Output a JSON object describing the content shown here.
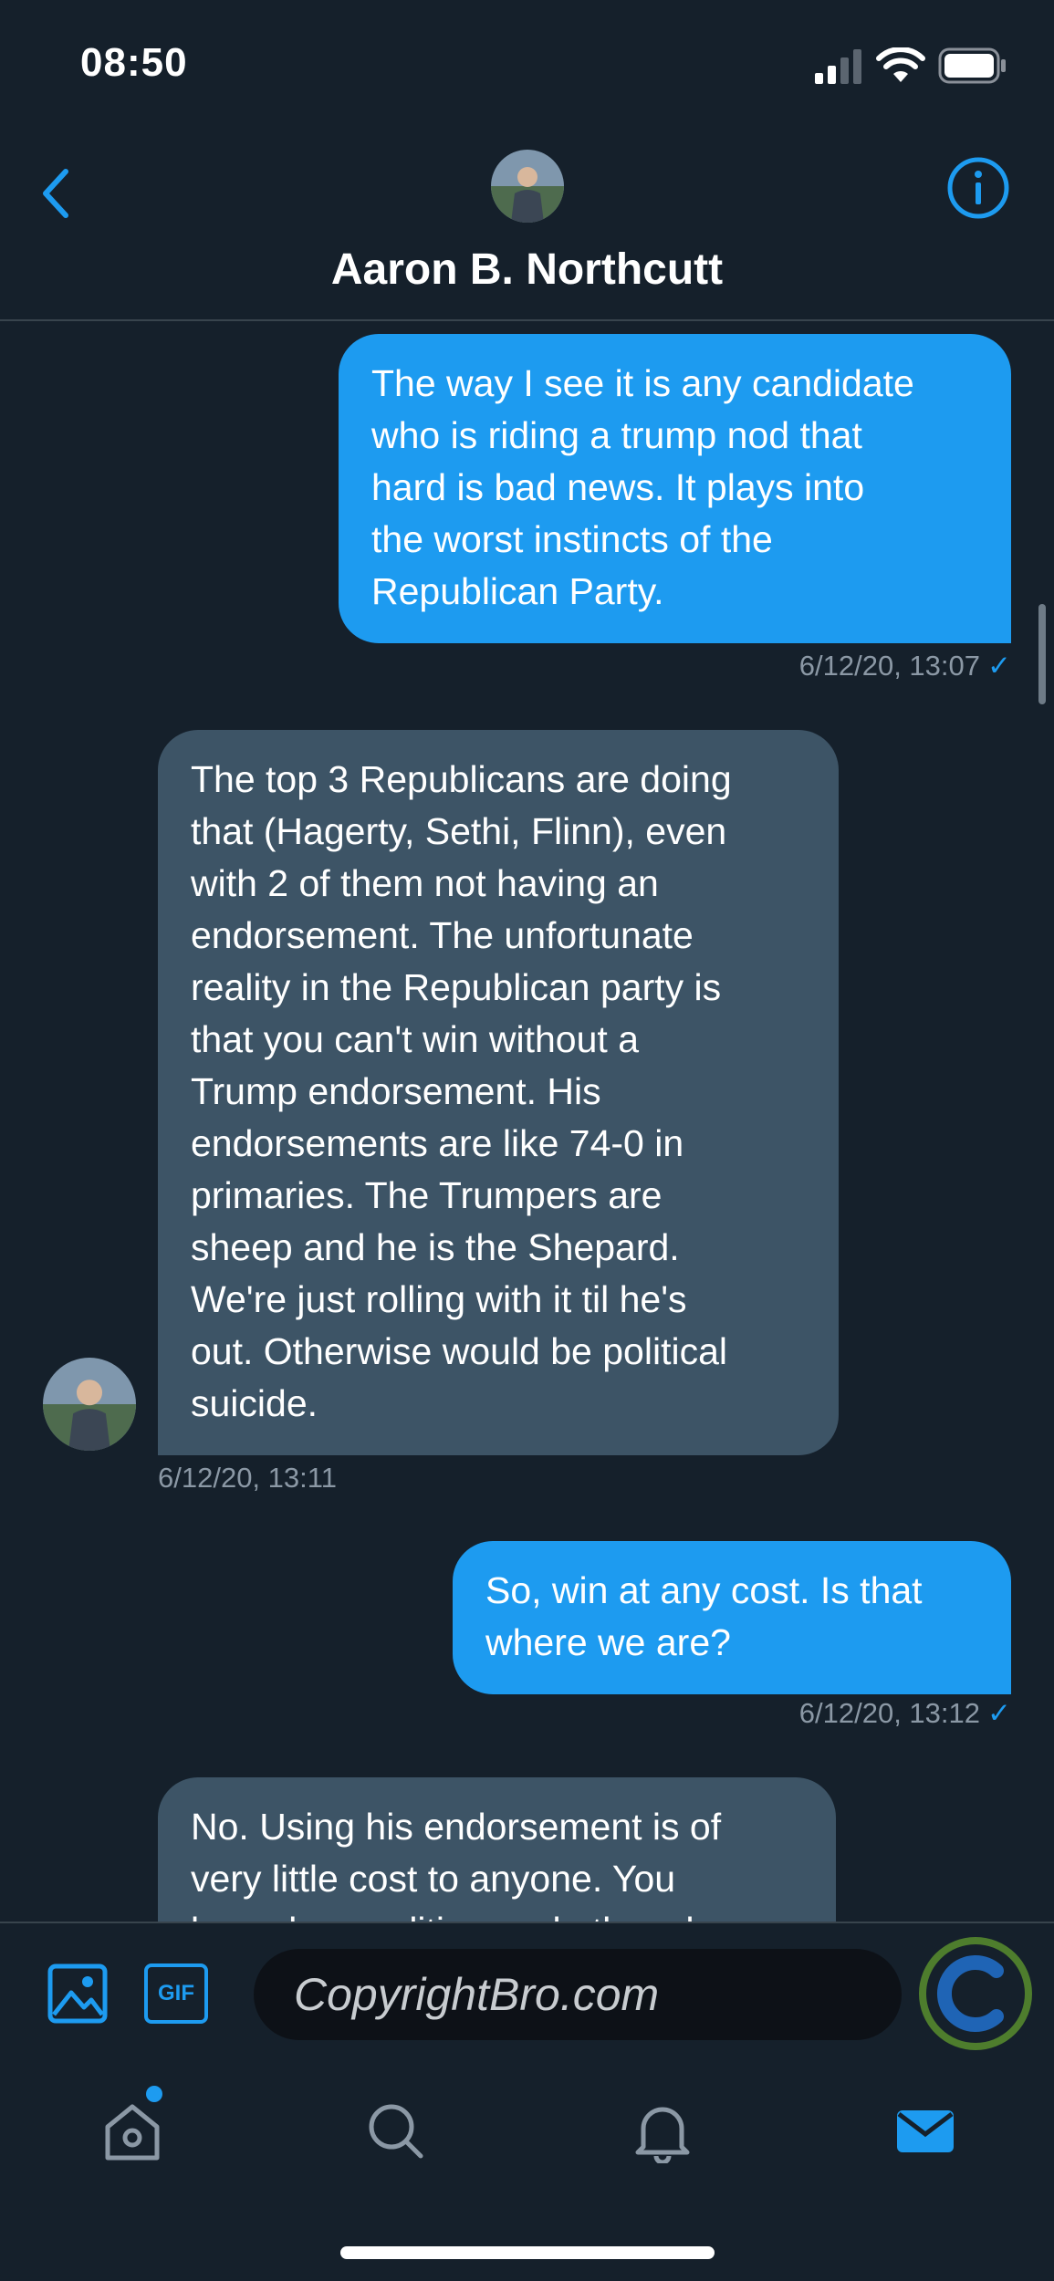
{
  "status_bar": {
    "time": "08:50"
  },
  "header": {
    "title": "Aaron B. Northcutt"
  },
  "messages": [
    {
      "direction": "sent",
      "text": "The way I see it is any candidate\nwho is riding a trump nod that\nhard is bad news. It plays into\nthe worst instincts of the\nRepublican Party.",
      "timestamp": "6/12/20, 13:07",
      "read_mark": "✓"
    },
    {
      "direction": "received",
      "text": "The top 3 Republicans are doing\nthat (Hagerty, Sethi, Flinn), even\nwith 2 of them not having an\nendorsement. The unfortunate\nreality in the Republican party is\nthat you can't win without a\nTrump endorsement. His\nendorsements are like 74-0 in\nprimaries. The Trumpers are\nsheep and he is the Shepard.\nWe're just rolling with it til he's\nout. Otherwise would be political\nsuicide.",
      "timestamp": "6/12/20, 13:11"
    },
    {
      "direction": "sent",
      "text": "So, win at any cost. Is that\nwhere we are?",
      "timestamp": "6/12/20, 13:12",
      "read_mark": "✓"
    },
    {
      "direction": "received",
      "text": "No. Using his endorsement is of\nvery little cost to anyone. You\nknow how politics work, though"
    }
  ],
  "composer": {
    "gif_label": "GIF",
    "input_value": "CopyrightBro.com",
    "watermark_letter": "C"
  },
  "icons": {
    "back": "chevron-left-icon",
    "info": "info-circle-icon",
    "image": "image-icon",
    "home": "home-icon",
    "search": "search-icon",
    "notifications": "bell-icon",
    "messages": "mail-icon"
  },
  "colors": {
    "background": "#15202b",
    "accent": "#1d9bf0",
    "sent_bubble": "#1d9bf0",
    "received_bubble": "#3d5466",
    "muted_text": "#8b98a5",
    "watermark_ring": "#4e7d2d"
  }
}
